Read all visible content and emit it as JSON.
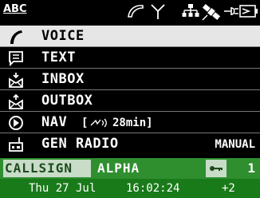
{
  "status": {
    "app_label": "ABC",
    "icons": [
      "call-icon",
      "antenna-icon",
      "network-icon",
      "satellite-icon",
      "power-plug-icon",
      "battery-icon"
    ]
  },
  "menu": [
    {
      "label": "VOICE",
      "icon": "phone-icon",
      "selected": true
    },
    {
      "label": "TEXT",
      "icon": "message-icon",
      "selected": false
    },
    {
      "label": "INBOX",
      "icon": "inbox-icon",
      "selected": false
    },
    {
      "label": "OUTBOX",
      "icon": "outbox-icon",
      "selected": false
    },
    {
      "label": "NAV",
      "icon": "nav-icon",
      "selected": false,
      "extra": "[",
      "extra_time": "28min]"
    },
    {
      "label": "GEN RADIO",
      "icon": "radio-icon",
      "selected": false,
      "right": "MANUAL"
    }
  ],
  "callsign": {
    "label": "CALLSIGN",
    "value": "ALPHA",
    "count": "1"
  },
  "datebar": {
    "date": "Thu 27 Jul",
    "time": "16:02:24",
    "offset": "+2"
  },
  "colors": {
    "selected_bg": "#e6e6e6",
    "callsign_bg": "#2f8f2f",
    "date_bg": "#197a19"
  }
}
